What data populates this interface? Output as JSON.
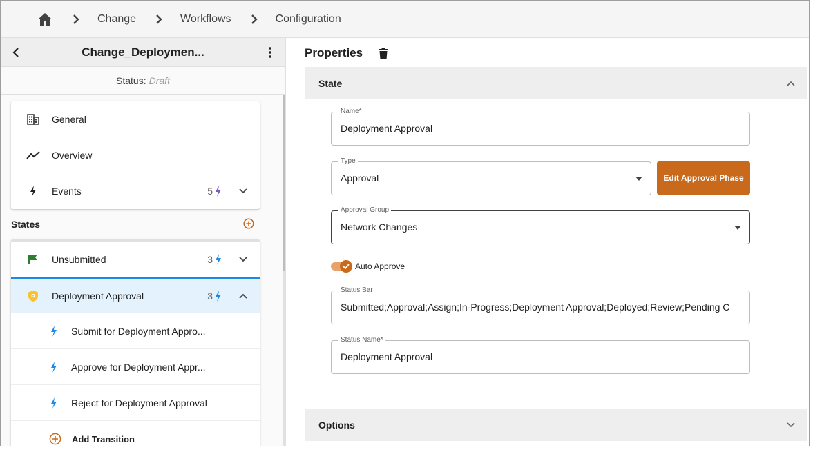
{
  "breadcrumb": {
    "items": [
      "Change",
      "Workflows",
      "Configuration"
    ]
  },
  "left": {
    "title": "Change_Deploymen...",
    "status_label": "Status:",
    "status_value": "Draft",
    "nav": [
      {
        "label": "General"
      },
      {
        "label": "Overview"
      },
      {
        "label": "Events",
        "count": "5"
      }
    ],
    "states_title": "States",
    "states": [
      {
        "label": "Unsubmitted",
        "count": "3"
      },
      {
        "label": "Deployment Approval",
        "count": "3"
      }
    ],
    "transitions": [
      {
        "label": "Submit for Deployment Appro..."
      },
      {
        "label": "Approve for Deployment Appr..."
      },
      {
        "label": "Reject for Deployment Approval"
      }
    ],
    "add_transition_label": "Add Transition"
  },
  "right": {
    "title": "Properties",
    "state_section": "State",
    "options_section": "Options",
    "fields": {
      "name": {
        "label": "Name*",
        "value": "Deployment Approval"
      },
      "type": {
        "label": "Type",
        "value": "Approval"
      },
      "approval_group": {
        "label": "Approval Group",
        "value": "Network Changes"
      },
      "status_bar": {
        "label": "Status Bar",
        "value": "Submitted;Approval;Assign;In-Progress;Deployment Approval;Deployed;Review;Pending C"
      },
      "status_name": {
        "label": "Status Name*",
        "value": "Deployment Approval"
      }
    },
    "edit_button": "Edit Approval Phase",
    "auto_approve_label": "Auto Approve",
    "auto_approve_on": true
  },
  "colors": {
    "accent": "#c8691b",
    "selected_border": "#1e88e5",
    "selected_bg": "#e3f2fd",
    "bolt_blue": "#1e88e5",
    "bolt_purple": "#7e57c2",
    "flag_green": "#2e7d32",
    "shield_yellow": "#f9c22e"
  }
}
